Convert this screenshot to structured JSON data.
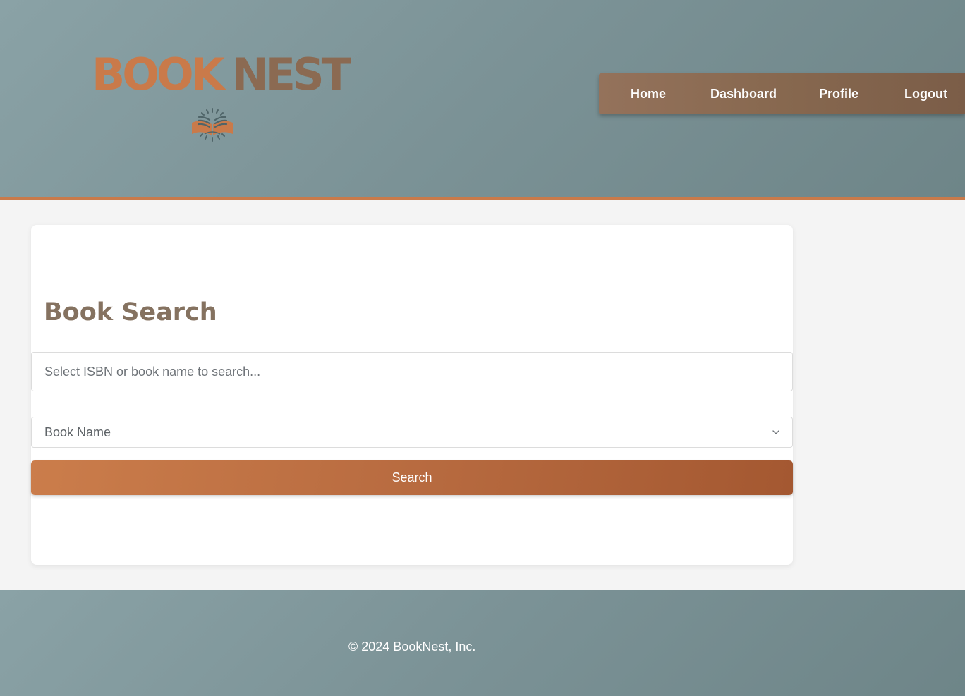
{
  "brand": {
    "word1": "BOOK",
    "word2": "NEST",
    "emblem_icon": "open-book-icon",
    "primary_color": "#c97a4a",
    "secondary_color": "#8b6a52"
  },
  "nav": {
    "items": [
      {
        "label": "Home"
      },
      {
        "label": "Dashboard"
      },
      {
        "label": "Profile"
      },
      {
        "label": "Logout"
      }
    ]
  },
  "search": {
    "title": "Book Search",
    "input_placeholder": "Select ISBN or book name to search...",
    "input_value": "",
    "search_type_selected": "Book Name",
    "button_label": "Search"
  },
  "footer": {
    "copyright": "© 2024 BookNest, Inc."
  },
  "colors": {
    "header_bg": "#7b9296",
    "accent": "#c97a4a",
    "nav_bg": "#87684f",
    "title_text": "#857260",
    "page_bg": "#f4f4f4"
  }
}
